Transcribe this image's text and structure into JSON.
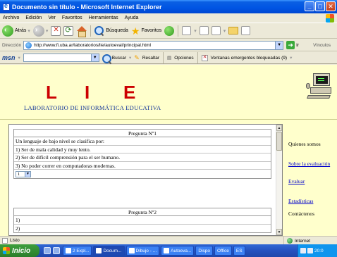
{
  "window": {
    "title": "Documento sin título - Microsoft Internet Explorer",
    "controls": {
      "minimize": "_",
      "maximize": "□",
      "close": "✕"
    }
  },
  "menu": [
    "Archivo",
    "Edición",
    "Ver",
    "Favoritos",
    "Herramientas",
    "Ayuda"
  ],
  "toolbar": {
    "back": "Atrás",
    "search": "Búsqueda",
    "favorites": "Favoritos"
  },
  "address": {
    "label": "Dirección",
    "url": "http://www.fi.uba.ar/laboratorios/lie/autoeval/principal.html",
    "go": "Ir",
    "links": "Vínculos"
  },
  "msn": {
    "logo": "msn",
    "search": "Buscar",
    "highlight": "Resaltar",
    "options": "Opciones",
    "popups": "Ventanas emergentes bloqueadas (9)"
  },
  "page": {
    "header": {
      "letters": [
        "L",
        "I",
        "E"
      ],
      "subtitle": "LABORATORIO DE INFORMÁTICA EDUCATIVA"
    },
    "questions": [
      {
        "title": "Pregunta Nº1",
        "prompt": "Un lenguaje de bajo nivel se clasifica por:",
        "options": [
          "1) Ser de mala calidad y muy lento.",
          "2) Ser de difícil comprensión para el ser humano.",
          "3) No poder correr en computadoras modernas."
        ],
        "answer": "1"
      },
      {
        "title": "Pregunta Nº2",
        "options_visible": [
          "1)",
          "2)"
        ]
      }
    ],
    "nav": [
      {
        "label": "Quienes somos",
        "link": false
      },
      {
        "label": "Sobre la evaluación",
        "link": true
      },
      {
        "label": "Evaluar",
        "link": true
      },
      {
        "label": "Estadísticas",
        "link": true
      },
      {
        "label": "Contáctenos",
        "link": false
      }
    ]
  },
  "status": {
    "text": "Listo",
    "zone": "Internet"
  },
  "taskbar": {
    "start": "Inicio",
    "tasks": [
      "2 Expl...",
      "Docum...",
      "Dibujo - ...",
      "Autoeva...",
      "Dispo",
      "Office",
      "ES"
    ],
    "clock": "20:0"
  }
}
